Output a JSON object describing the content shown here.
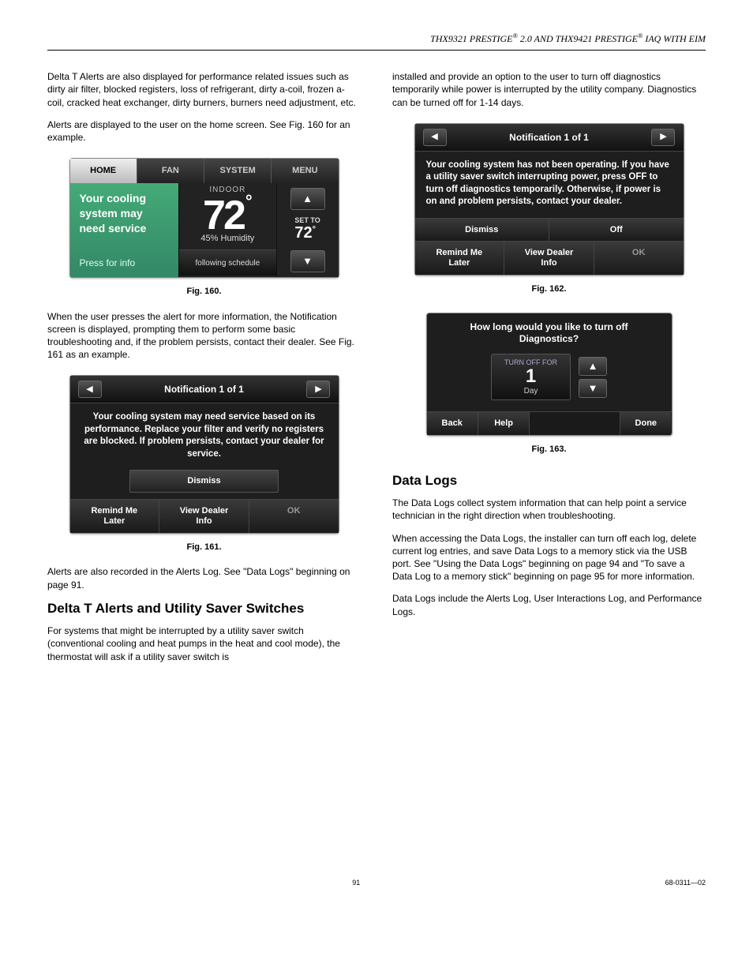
{
  "header": {
    "text_a": "THX9321 PRESTIGE",
    "reg": "®",
    "text_b": " 2.0 AND THX9421 PRESTIGE",
    "text_c": " IAQ WITH EIM"
  },
  "left": {
    "p1": "Delta T Alerts are also displayed for performance related issues such as dirty air filter, blocked registers, loss of refrigerant, dirty a-coil, frozen a-coil, cracked heat exchanger, dirty burners, burners need adjustment, etc.",
    "p2": "Alerts are displayed to the user on the home screen. See Fig. 160 for an example.",
    "fig160": {
      "tabs": {
        "home": "HOME",
        "fan": "FAN",
        "system": "SYSTEM",
        "menu": "MENU"
      },
      "alert_l1": "Your cooling",
      "alert_l2": "system may",
      "alert_l3": "need service",
      "press": "Press for info",
      "indoor": "INDOOR",
      "temp": "72",
      "deg": "°",
      "humid": "45% Humidity",
      "sched": "following schedule",
      "setto": "SET TO",
      "settemp": "72"
    },
    "cap160": "Fig. 160.",
    "p3": "When the user presses the alert for more information, the Notification screen is displayed, prompting them to perform some basic troubleshooting and, if the problem persists, contact their dealer. See Fig. 161 as an example.",
    "fig161": {
      "title": "Notification 1 of 1",
      "msg": "Your cooling system may need service based on its performance. Replace your filter and verify no registers are blocked. If problem persists, contact your dealer for service.",
      "dismiss": "Dismiss",
      "remind": "Remind Me\nLater",
      "view": "View Dealer\nInfo",
      "ok": "OK"
    },
    "cap161": "Fig. 161.",
    "p4": "Alerts are also recorded in the Alerts Log. See \"Data Logs\" beginning on page 91.",
    "h2": "Delta T Alerts and Utility Saver Switches",
    "p5": "For systems that might be interrupted by a utility saver switch (conventional cooling and heat pumps in the heat and cool mode), the thermostat will ask if a utility saver switch is"
  },
  "right": {
    "p1": "installed and provide an option to the user to turn off diagnostics temporarily while power is interrupted by the utility company. Diagnostics can be turned off for 1-14 days.",
    "fig162": {
      "title": "Notification 1 of 1",
      "msg": "Your cooling system has not been operating. If you have a utility saver switch interrupting power, press OFF to turn off diagnostics temporarily. Otherwise, if power is on and problem persists, contact your dealer.",
      "dismiss": "Dismiss",
      "off": "Off",
      "remind": "Remind Me\nLater",
      "view": "View Dealer\nInfo",
      "ok": "OK"
    },
    "cap162": "Fig. 162.",
    "fig163": {
      "q": "How long would you like to turn off Diagnostics?",
      "tof": "TURN OFF FOR",
      "val": "1",
      "day": "Day",
      "back": "Back",
      "help": "Help",
      "done": "Done"
    },
    "cap163": "Fig. 163.",
    "h2": "Data Logs",
    "p2": "The Data Logs collect system information that can help point a service technician in the right direction when troubleshooting.",
    "p3": "When accessing the Data Logs, the installer can turn off each log, delete current log entries, and save Data Logs to a memory stick via the USB port. See \"Using the Data Logs\" beginning on page 94 and \"To save a Data Log to a memory stick\" beginning on page 95 for more information.",
    "p4": "Data Logs include the Alerts Log, User Interactions Log, and Performance Logs."
  },
  "footer": {
    "page": "91",
    "doc": "68-0311—02"
  }
}
